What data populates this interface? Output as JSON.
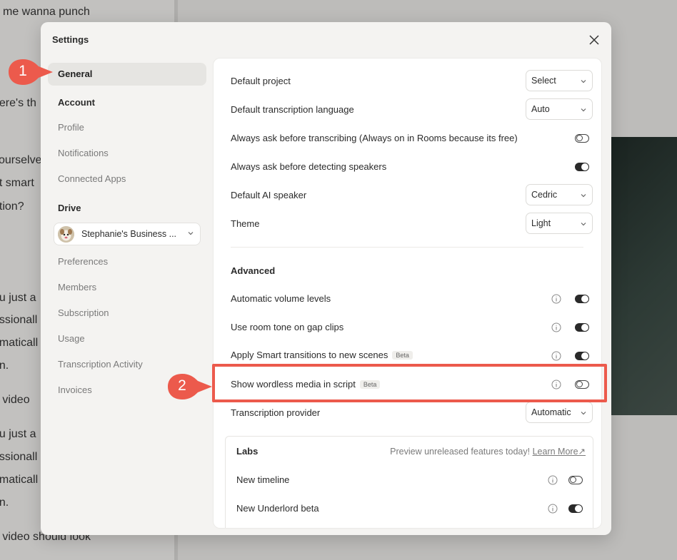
{
  "background_doc": {
    "lines": [
      "me wanna punch",
      "here's th",
      "yourselve",
      "ot smart",
      "ation?",
      "ou just a",
      "essionall",
      "omaticall",
      "on.",
      " a video",
      "ou just a",
      "essionall",
      "omaticall",
      "on.",
      " a video should look"
    ]
  },
  "modal": {
    "title": "Settings"
  },
  "sidebar": {
    "general": "General",
    "account_heading": "Account",
    "account_items": [
      "Profile",
      "Notifications",
      "Connected Apps"
    ],
    "drive_heading": "Drive",
    "drive_selector": "Stephanie's Business ...",
    "drive_items": [
      "Preferences",
      "Members",
      "Subscription",
      "Usage",
      "Transcription Activity",
      "Invoices"
    ]
  },
  "general_settings": [
    {
      "label": "Default project",
      "value": "Select"
    },
    {
      "label": "Default transcription language",
      "value": "Auto"
    },
    {
      "label": "Always ask before transcribing (Always on in Rooms because its free)",
      "toggle": false
    },
    {
      "label": "Always ask before detecting speakers",
      "toggle": true
    },
    {
      "label": "Default AI speaker",
      "value": "Cedric"
    },
    {
      "label": "Theme",
      "value": "Light"
    }
  ],
  "advanced": {
    "heading": "Advanced",
    "items": [
      {
        "label": "Automatic volume levels",
        "toggle": true
      },
      {
        "label": "Use room tone on gap clips",
        "toggle": true
      },
      {
        "label": "Apply Smart transitions to new scenes",
        "badge": "Beta",
        "toggle": true
      },
      {
        "label": "Show wordless media in script",
        "badge": "Beta",
        "toggle": false
      }
    ],
    "provider_label": "Transcription provider",
    "provider_value": "Automatic"
  },
  "labs": {
    "title": "Labs",
    "description": "Preview unreleased features today!",
    "link": "Learn More↗",
    "items": [
      {
        "label": "New timeline",
        "toggle": false
      },
      {
        "label": "New Underlord beta",
        "toggle": true
      }
    ]
  },
  "annotations": {
    "step1": "1",
    "step2": "2",
    "color": "#ec5a4c"
  }
}
